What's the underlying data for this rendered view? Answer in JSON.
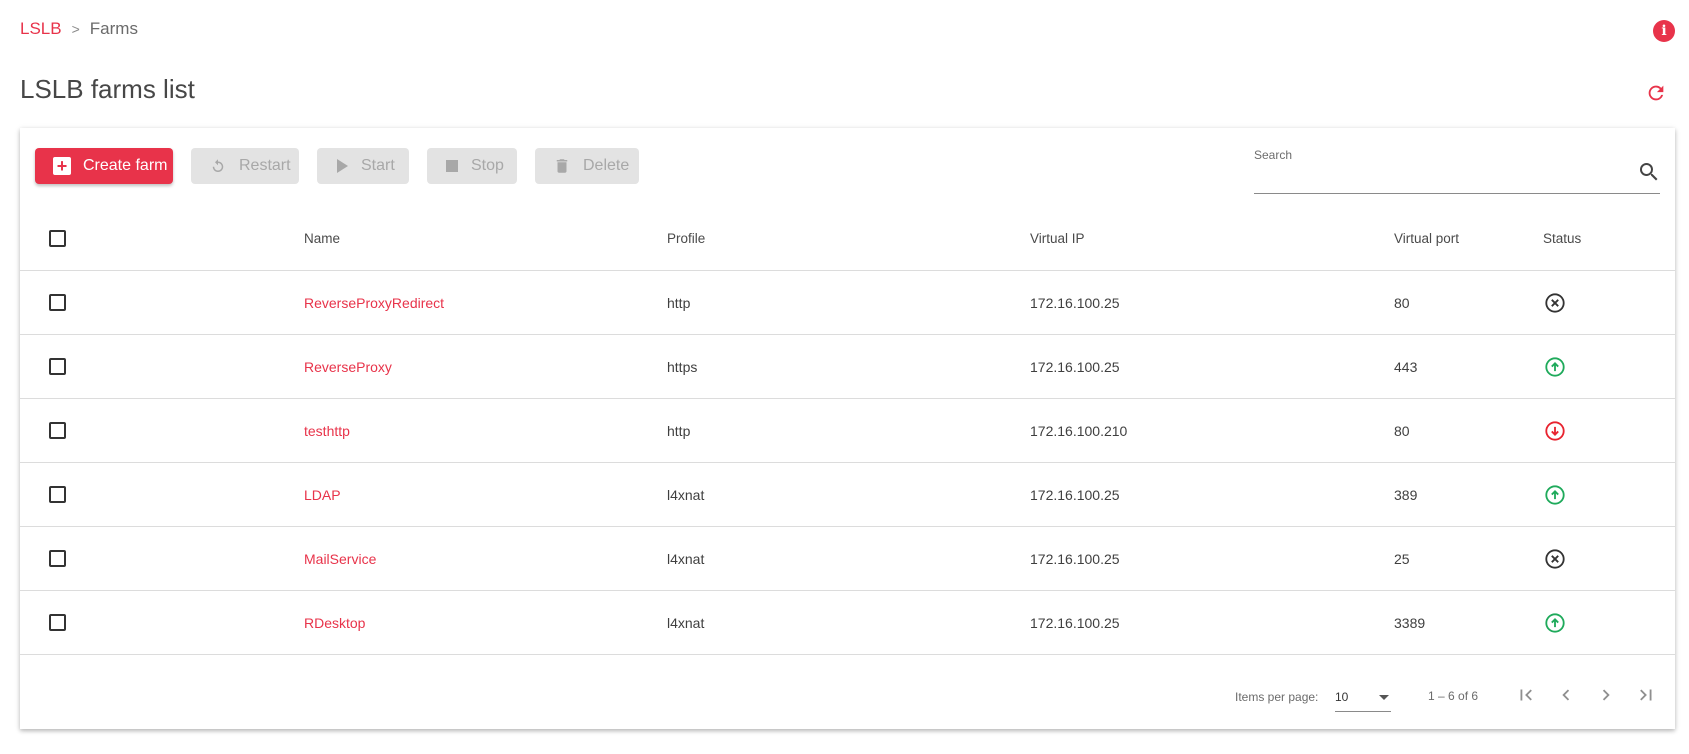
{
  "breadcrumb": {
    "root": "LSLB",
    "separator": ">",
    "current": "Farms"
  },
  "header": {
    "title": "LSLB farms list",
    "info_icon": "info-icon",
    "refresh_icon": "refresh-icon"
  },
  "toolbar": {
    "create_label": "Create farm",
    "restart_label": "Restart",
    "start_label": "Start",
    "stop_label": "Stop",
    "delete_label": "Delete"
  },
  "search": {
    "label": "Search",
    "value": ""
  },
  "table": {
    "columns": [
      "Name",
      "Profile",
      "Virtual IP",
      "Virtual port",
      "Status"
    ],
    "rows": [
      {
        "name": "ReverseProxyRedirect",
        "profile": "http",
        "vip": "172.16.100.25",
        "port": "80",
        "status": "down"
      },
      {
        "name": "ReverseProxy",
        "profile": "https",
        "vip": "172.16.100.25",
        "port": "443",
        "status": "up"
      },
      {
        "name": "testhttp",
        "profile": "http",
        "vip": "172.16.100.210",
        "port": "80",
        "status": "critical"
      },
      {
        "name": "LDAP",
        "profile": "l4xnat",
        "vip": "172.16.100.25",
        "port": "389",
        "status": "up"
      },
      {
        "name": "MailService",
        "profile": "l4xnat",
        "vip": "172.16.100.25",
        "port": "25",
        "status": "down"
      },
      {
        "name": "RDesktop",
        "profile": "l4xnat",
        "vip": "172.16.100.25",
        "port": "3389",
        "status": "up"
      }
    ]
  },
  "paginator": {
    "items_per_page_label": "Items per page:",
    "page_size": "10",
    "range_label": "1 – 6 of 6"
  },
  "colors": {
    "accent": "#e8334a",
    "up": "#1faa5b",
    "down": "#333333",
    "critical": "#e8232f"
  }
}
